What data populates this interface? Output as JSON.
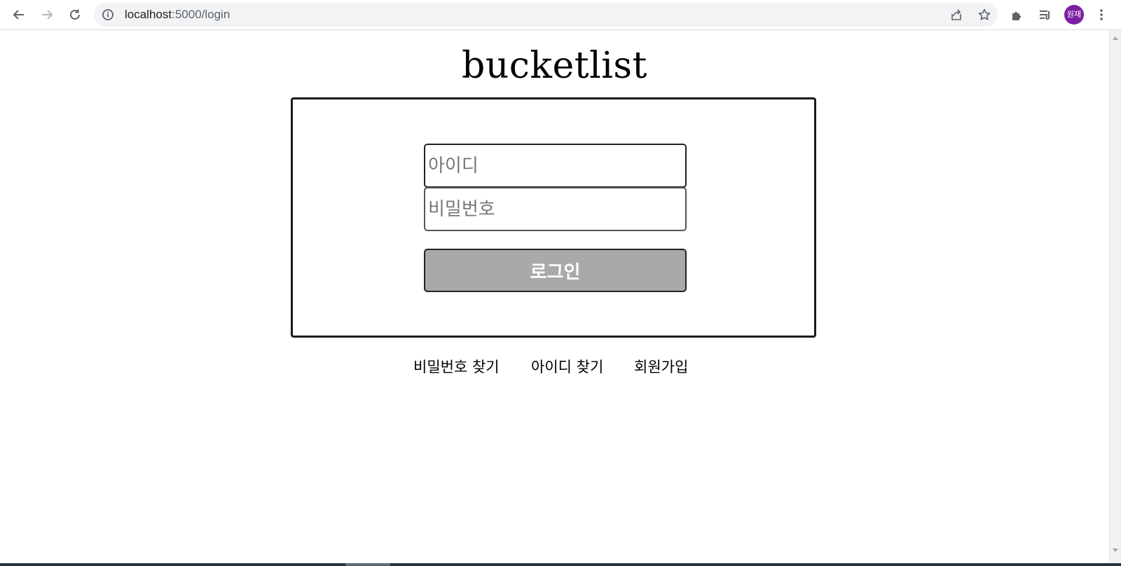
{
  "browser": {
    "url_host": "localhost",
    "url_rest": ":5000/login",
    "profile_initials": "원재",
    "icons": [
      "back-icon",
      "forward-icon",
      "reload-icon",
      "site-info-icon",
      "share-icon",
      "bookmark-star-icon",
      "extensions-icon",
      "reading-list-icon",
      "more-menu-icon"
    ]
  },
  "page": {
    "title": "bucketlist",
    "id_placeholder": "아이디",
    "pw_placeholder": "비밀번호",
    "login_label": "로그인",
    "links": {
      "find_password": "비밀번호 찾기",
      "find_id": "아이디 찾기",
      "signup": "회원가입"
    }
  }
}
